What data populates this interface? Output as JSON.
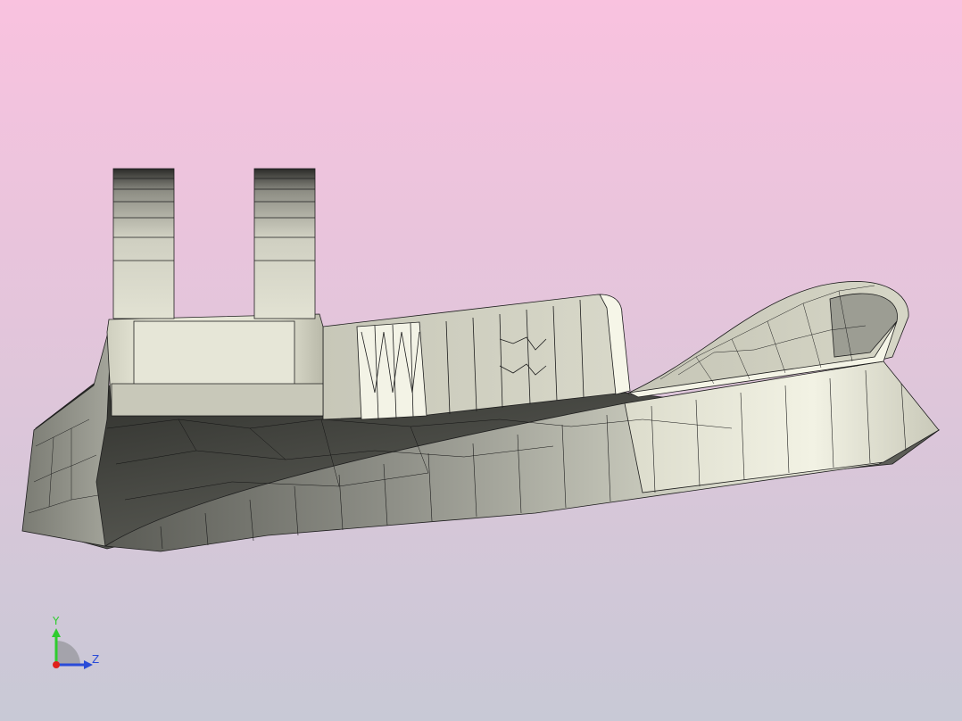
{
  "viewport": {
    "background_top_color": "#f9c2df",
    "background_bottom_color": "#c8c9d6",
    "model_face_color": "#e3e3d4",
    "model_shadow_color": "#4a4b45",
    "mesh_line_color": "#1e1e1e"
  },
  "triad": {
    "y_label": "Y",
    "z_label": "Z",
    "y_axis_color": "#2ecc2e",
    "z_axis_color": "#2a4bd8",
    "x_axis_color": "#e0201a"
  }
}
